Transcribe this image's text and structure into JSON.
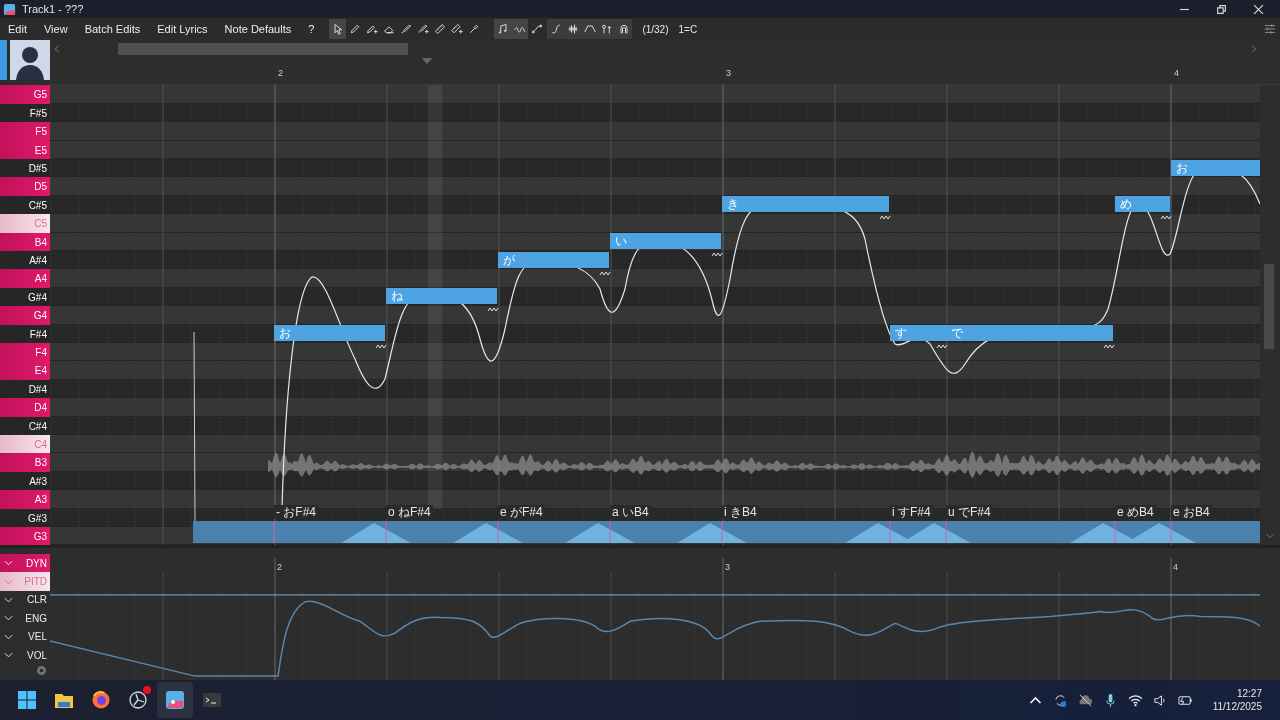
{
  "window": {
    "title": "Track1 - ???"
  },
  "menu": [
    "Edit",
    "View",
    "Batch Edits",
    "Edit Lyrics",
    "Note Defaults",
    "?"
  ],
  "tools": [
    {
      "kind": "pointer",
      "selected": true
    },
    {
      "kind": "pencil",
      "selected": false
    },
    {
      "kind": "pencil-plus",
      "selected": false
    },
    {
      "kind": "eraser",
      "selected": false
    },
    {
      "kind": "brush",
      "selected": false
    },
    {
      "kind": "brush-plus",
      "selected": false
    },
    {
      "kind": "ruler",
      "selected": false
    },
    {
      "kind": "ruler-plus",
      "selected": false
    },
    {
      "kind": "dropper",
      "selected": false
    }
  ],
  "toggles": [
    {
      "kind": "note",
      "on": true
    },
    {
      "kind": "wave",
      "on": true
    },
    {
      "kind": "pitch-point",
      "on": false
    }
  ],
  "view_options": [
    {
      "kind": "ramp",
      "on": true
    },
    {
      "kind": "waveform",
      "on": true
    },
    {
      "kind": "trapezoid",
      "on": true
    },
    {
      "kind": "pins",
      "on": true
    },
    {
      "kind": "arch",
      "on": true
    }
  ],
  "snap": "(1/32)",
  "key": "1=C",
  "ruler": [
    "2",
    "3",
    "4"
  ],
  "keys": [
    {
      "name": "G5",
      "kind": "white"
    },
    {
      "name": "F#5",
      "kind": "black"
    },
    {
      "name": "F5",
      "kind": "white"
    },
    {
      "name": "E5",
      "kind": "white"
    },
    {
      "name": "D#5",
      "kind": "black"
    },
    {
      "name": "D5",
      "kind": "white"
    },
    {
      "name": "C#5",
      "kind": "black"
    },
    {
      "name": "C5",
      "kind": "c"
    },
    {
      "name": "B4",
      "kind": "white"
    },
    {
      "name": "A#4",
      "kind": "black"
    },
    {
      "name": "A4",
      "kind": "white"
    },
    {
      "name": "G#4",
      "kind": "black"
    },
    {
      "name": "G4",
      "kind": "white"
    },
    {
      "name": "F#4",
      "kind": "black"
    },
    {
      "name": "F4",
      "kind": "white"
    },
    {
      "name": "E4",
      "kind": "white"
    },
    {
      "name": "D#4",
      "kind": "black"
    },
    {
      "name": "D4",
      "kind": "white"
    },
    {
      "name": "C#4",
      "kind": "black"
    },
    {
      "name": "C4",
      "kind": "c"
    },
    {
      "name": "B3",
      "kind": "white"
    },
    {
      "name": "A#3",
      "kind": "black"
    },
    {
      "name": "A3",
      "kind": "white"
    },
    {
      "name": "G#3",
      "kind": "black"
    },
    {
      "name": "G3",
      "kind": "white"
    }
  ],
  "notes": [
    {
      "lyric": "お",
      "vibrato": true
    },
    {
      "lyric": "ね",
      "vibrato": true
    },
    {
      "lyric": "が",
      "vibrato": true
    },
    {
      "lyric": "い",
      "vibrato": true
    },
    {
      "lyric": "き",
      "vibrato": true
    },
    {
      "lyric": "す",
      "vibrato": true
    },
    {
      "lyric": "で",
      "vibrato": true
    },
    {
      "lyric": "め",
      "vibrato": true
    },
    {
      "lyric": "お",
      "vibrato": false
    }
  ],
  "phonemes": [
    "- おF#4",
    "o ねF#4",
    "e がF#4",
    "a いB4",
    "i きB4",
    "i すF#4",
    "u でF#4",
    "e めB4",
    "e おB4"
  ],
  "expressions": [
    {
      "label": "DYN",
      "selected": true,
      "secondary": false
    },
    {
      "label": "PITD",
      "selected": false,
      "secondary": true
    },
    {
      "label": "CLR",
      "selected": false,
      "secondary": false
    },
    {
      "label": "ENG",
      "selected": false,
      "secondary": false
    },
    {
      "label": "VEL",
      "selected": false,
      "secondary": false
    },
    {
      "label": "VOL",
      "selected": false,
      "secondary": false
    }
  ],
  "lower_ruler": [
    "2",
    "3",
    "4"
  ],
  "taskbar": {
    "apps": [
      {
        "kind": "windows",
        "active": false,
        "notification": false
      },
      {
        "kind": "folder",
        "active": false,
        "notification": false
      },
      {
        "kind": "browser",
        "active": false,
        "notification": false
      },
      {
        "kind": "recorder",
        "active": false,
        "notification": true
      },
      {
        "kind": "editor",
        "active": true,
        "notification": false
      },
      {
        "kind": "terminal",
        "active": false,
        "notification": false
      }
    ],
    "time": "12:27",
    "date": "11/12/2025"
  }
}
